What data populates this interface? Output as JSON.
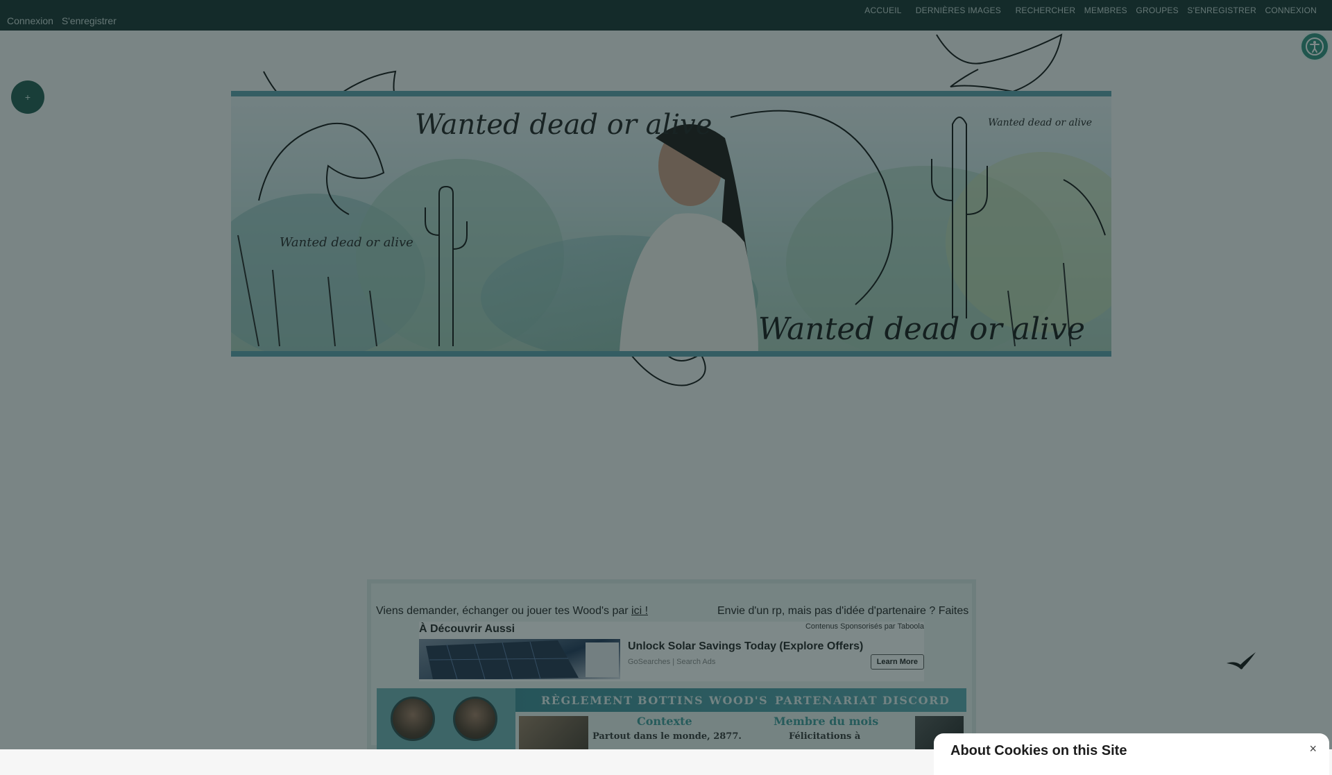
{
  "topbar": {
    "left_links": [
      "Connexion",
      "S'enregistrer"
    ],
    "right_links": [
      "ACCUEIL",
      "DERNIÈRES IMAGES",
      "RECHERCHER",
      "MEMBRES",
      "GROUPES",
      "S'ENREGISTRER",
      "CONNEXION"
    ]
  },
  "plus_button": "+",
  "banner": {
    "title_top": "Wanted dead or alive",
    "title_small_left": "Wanted dead or alive",
    "title_small_right": "Wanted dead or alive",
    "title_bottom": "Wanted dead or alive"
  },
  "marquee": {
    "text1": "Viens demander, échanger ou jouer tes Wood's par ",
    "link1": "ici !",
    "text2": "Envie d'un rp, mais pas d'idée d'partenaire ? Faites"
  },
  "ad": {
    "title": "À Découvrir Aussi",
    "sponsor": "Contenus Sponsorisés par Taboola",
    "headline": "Unlock Solar Savings Today (Explore Offers)",
    "source": "GoSearches | Search Ads",
    "cta": "Learn More"
  },
  "forum": {
    "nav": [
      "RÈGLEMENT",
      "BOTTINS",
      "WOOD'S",
      "PARTENARIAT",
      "DISCORD"
    ],
    "context_title": "Contexte",
    "context_text": "Partout dans le monde, 2877.",
    "member_title": "Membre du mois",
    "member_text": "Félicitations à"
  },
  "cookie": {
    "title": "About Cookies on this Site",
    "close": "×"
  },
  "colors": {
    "topbar": "#14302e",
    "accent": "#5c9eaa",
    "accessibility": "#2f8f7c"
  }
}
